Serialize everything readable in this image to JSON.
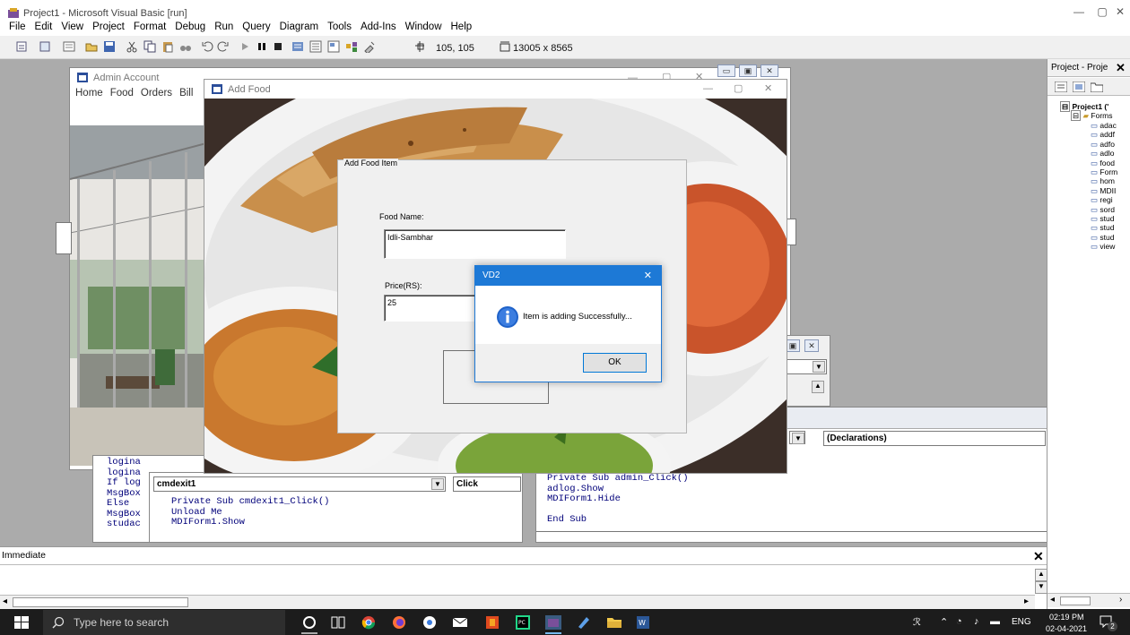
{
  "window": {
    "title": "Project1 - Microsoft Visual Basic [run]"
  },
  "menu": [
    "File",
    "Edit",
    "View",
    "Project",
    "Format",
    "Debug",
    "Run",
    "Query",
    "Diagram",
    "Tools",
    "Add-Ins",
    "Window",
    "Help"
  ],
  "toolbar": {
    "position": "105, 105",
    "size": "13005 x 8565"
  },
  "admin_form": {
    "title": "Admin Account",
    "menu": [
      "Home",
      "Food",
      "Orders",
      "Bill"
    ]
  },
  "add_food_form": {
    "title": "Add Food",
    "frame_label": "Add Food Item",
    "food_name_label": "Food Name:",
    "food_name_value": "Idli-Sambhar",
    "price_label": "Price(RS):",
    "price_value": "25"
  },
  "msgbox": {
    "title": "VD2",
    "message": "Item is adding Successfully...",
    "ok_label": "OK",
    "close_glyph": "✕"
  },
  "code_left": {
    "object_combo": "cmdexit1",
    "event_combo": "Click",
    "lines": [
      "Private Sub cmdexit1_Click()",
      "Unload Me",
      "MDIForm1.Show"
    ],
    "behind_lines": [
      "logina",
      "logina",
      "If log",
      "MsgBox",
      "Else",
      "MsgBox",
      "studac"
    ]
  },
  "code_right": {
    "event_combo": "(Declarations)",
    "lines": [
      "Private Sub admin_Click()",
      "adlog.Show",
      "MDIForm1.Hide",
      "",
      "End Sub"
    ]
  },
  "immediate": {
    "title": "Immediate",
    "close_glyph": "✕"
  },
  "project_panel": {
    "title": "Project - Proje",
    "close_glyph": "✕",
    "root": "Project1 ('",
    "folder": "Forms",
    "items": [
      "adac",
      "addf",
      "adfo",
      "adlo",
      "food",
      "Form",
      "hom",
      "MDII",
      "regi",
      "sord",
      "stud",
      "stud",
      "stud",
      "view"
    ]
  },
  "taskbar": {
    "search_placeholder": "Type here to search",
    "language": "ENG",
    "time": "02:19 PM",
    "date": "02-04-2021",
    "notification_count": "2"
  },
  "colors": {
    "accent": "#1d79d6",
    "mdi_background": "#ababab",
    "code_text": "#00007a",
    "taskbar": "#1c1c1c"
  }
}
